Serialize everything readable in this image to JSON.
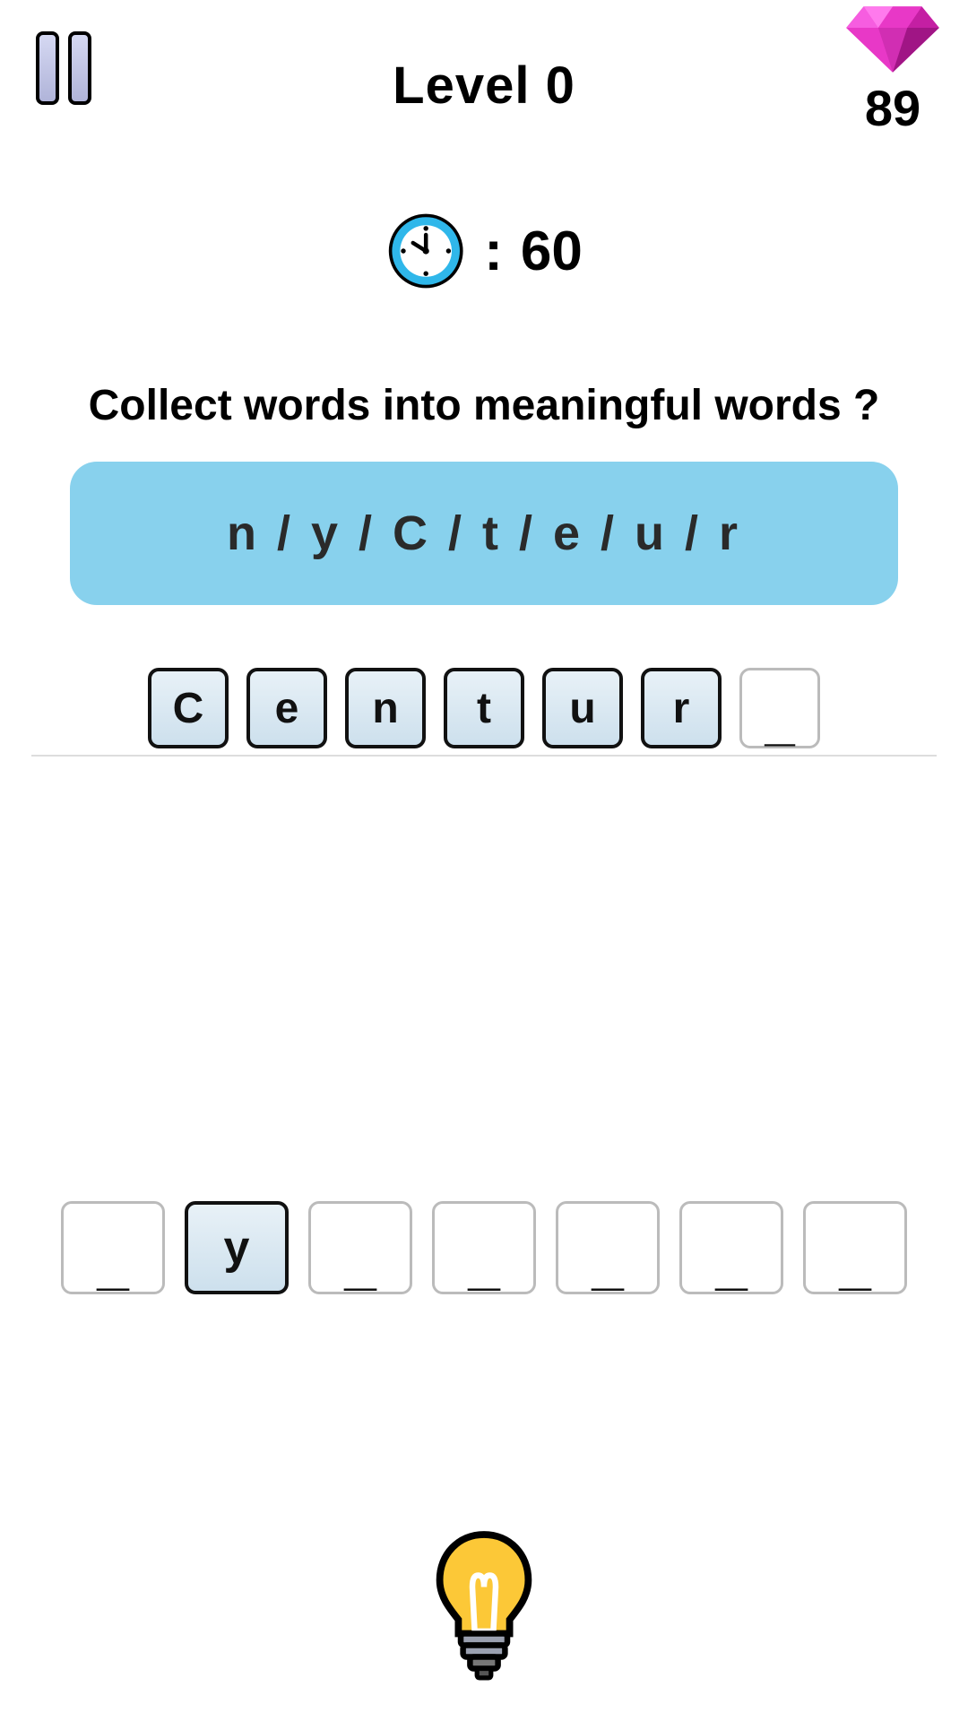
{
  "header": {
    "level_label": "Level 0",
    "gem_count": "89"
  },
  "timer": {
    "separator": ":",
    "value": "60"
  },
  "instruction": "Collect words into meaningful words ?",
  "scrambled": "n / y / C / t / e / u / r",
  "answer_tiles": [
    {
      "letter": "C",
      "filled": true
    },
    {
      "letter": "e",
      "filled": true
    },
    {
      "letter": "n",
      "filled": true
    },
    {
      "letter": "t",
      "filled": true
    },
    {
      "letter": "u",
      "filled": true
    },
    {
      "letter": "r",
      "filled": true
    },
    {
      "letter": "_",
      "filled": false
    }
  ],
  "input_tiles": [
    {
      "letter": "_",
      "has_letter": false
    },
    {
      "letter": "y",
      "has_letter": true
    },
    {
      "letter": "_",
      "has_letter": false
    },
    {
      "letter": "_",
      "has_letter": false
    },
    {
      "letter": "_",
      "has_letter": false
    },
    {
      "letter": "_",
      "has_letter": false
    },
    {
      "letter": "_",
      "has_letter": false
    }
  ],
  "colors": {
    "accent_blue": "#88d1ed",
    "gem_pink": "#e838c7",
    "clock_blue": "#2fb7ea",
    "bulb_yellow": "#fcc837"
  }
}
